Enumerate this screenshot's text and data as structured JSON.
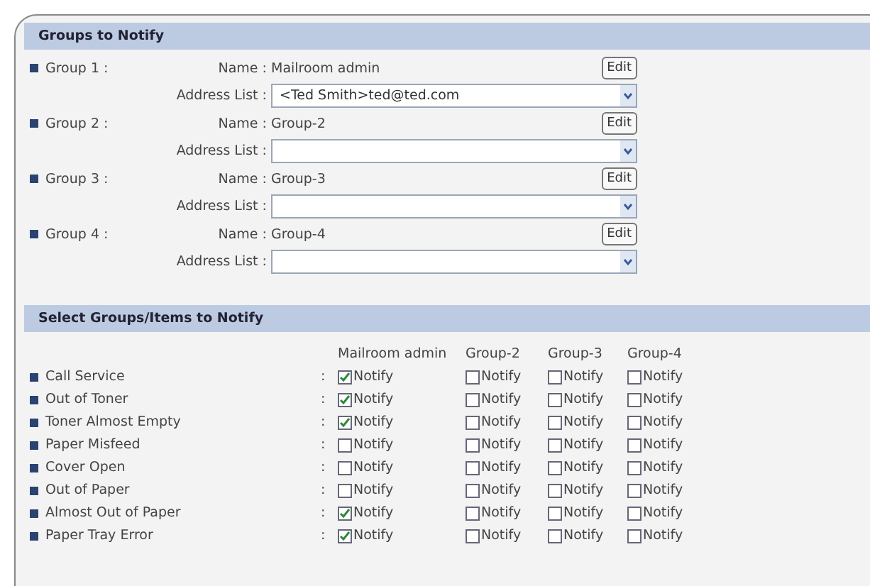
{
  "groups_section": {
    "title": "Groups to Notify",
    "groups": [
      {
        "label": "Group 1 :",
        "name_label": "Name :",
        "name": "Mailroom admin",
        "edit": "Edit",
        "address_label": "Address List :",
        "address": "<Ted Smith>ted@ted.com"
      },
      {
        "label": "Group 2 :",
        "name_label": "Name :",
        "name": "Group-2",
        "edit": "Edit",
        "address_label": "Address List :"
      },
      {
        "label": "Group 3 :",
        "name_label": "Name :",
        "name": "Group-3",
        "edit": "Edit",
        "address_label": "Address List :"
      },
      {
        "label": "Group 4 :",
        "name_label": "Name :",
        "name": "Group-4",
        "edit": "Edit",
        "address_label": "Address List :"
      }
    ]
  },
  "items_section": {
    "title": "Select Groups/Items to Notify",
    "columns": [
      "Mailroom admin",
      "Group-2",
      "Group-3",
      "Group-4"
    ],
    "items": [
      {
        "label": "Call Service",
        "separator": ":",
        "checks": [
          {
            "label": "Notify",
            "checked": true
          },
          {
            "label": "Notify",
            "checked": false
          },
          {
            "label": "Notify",
            "checked": false
          },
          {
            "label": "Notify",
            "checked": false
          }
        ]
      },
      {
        "label": "Out of Toner",
        "separator": ":",
        "checks": [
          {
            "label": "Notify",
            "checked": true
          },
          {
            "label": "Notify",
            "checked": false
          },
          {
            "label": "Notify",
            "checked": false
          },
          {
            "label": "Notify",
            "checked": false
          }
        ]
      },
      {
        "label": "Toner Almost Empty",
        "separator": ":",
        "checks": [
          {
            "label": "Notify",
            "checked": true
          },
          {
            "label": "Notify",
            "checked": false
          },
          {
            "label": "Notify",
            "checked": false
          },
          {
            "label": "Notify",
            "checked": false
          }
        ]
      },
      {
        "label": "Paper Misfeed",
        "separator": ":",
        "checks": [
          {
            "label": "Notify",
            "checked": false
          },
          {
            "label": "Notify",
            "checked": false
          },
          {
            "label": "Notify",
            "checked": false
          },
          {
            "label": "Notify",
            "checked": false
          }
        ]
      },
      {
        "label": "Cover Open",
        "separator": ":",
        "checks": [
          {
            "label": "Notify",
            "checked": false
          },
          {
            "label": "Notify",
            "checked": false
          },
          {
            "label": "Notify",
            "checked": false
          },
          {
            "label": "Notify",
            "checked": false
          }
        ]
      },
      {
        "label": "Out of Paper",
        "separator": ":",
        "checks": [
          {
            "label": "Notify",
            "checked": false
          },
          {
            "label": "Notify",
            "checked": false
          },
          {
            "label": "Notify",
            "checked": false
          },
          {
            "label": "Notify",
            "checked": false
          }
        ]
      },
      {
        "label": "Almost Out of Paper",
        "separator": ":",
        "checks": [
          {
            "label": "Notify",
            "checked": true
          },
          {
            "label": "Notify",
            "checked": false
          },
          {
            "label": "Notify",
            "checked": false
          },
          {
            "label": "Notify",
            "checked": false
          }
        ]
      },
      {
        "label": "Paper Tray Error",
        "separator": ":",
        "checks": [
          {
            "label": "Notify",
            "checked": true
          },
          {
            "label": "Notify",
            "checked": false
          },
          {
            "label": "Notify",
            "checked": false
          },
          {
            "label": "Notify",
            "checked": false
          }
        ]
      }
    ]
  }
}
